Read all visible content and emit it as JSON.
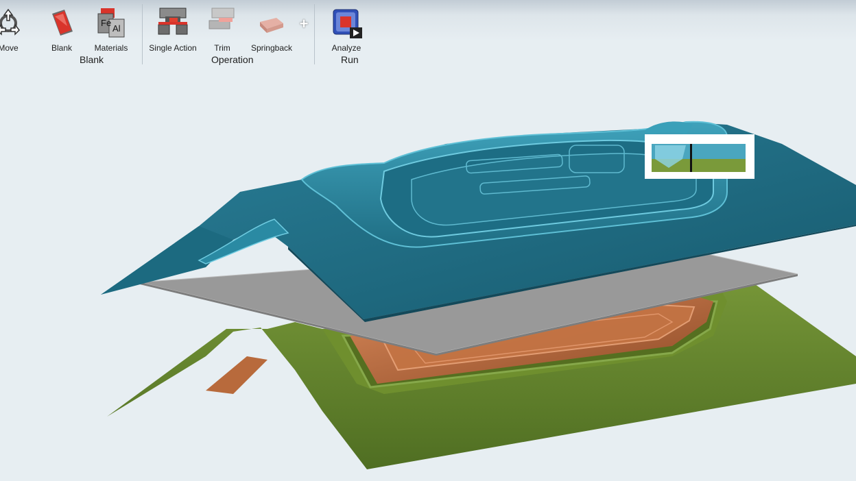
{
  "ribbon": {
    "buttons": {
      "move": "Move",
      "blank": "Blank",
      "materials": "Materials",
      "single_action": "Single Action",
      "trim": "Trim",
      "springback": "Springback",
      "analyze": "Analyze"
    },
    "materials_icon_text": {
      "fe": "Fe",
      "al": "Al"
    },
    "add_symbol": "+",
    "groups": {
      "blank": "Blank",
      "operation": "Operation",
      "run": "Run"
    }
  },
  "colors": {
    "upper_die": "#1f6e84",
    "blank_sheet": "#9a9a9a",
    "lower_binder": "#5a7a26",
    "punch": "#b86a3c",
    "background": "#e7eef2"
  },
  "icons": [
    "move-icon",
    "blank-icon",
    "materials-icon",
    "single-action-icon",
    "trim-icon",
    "springback-icon",
    "add-icon",
    "analyze-icon"
  ]
}
